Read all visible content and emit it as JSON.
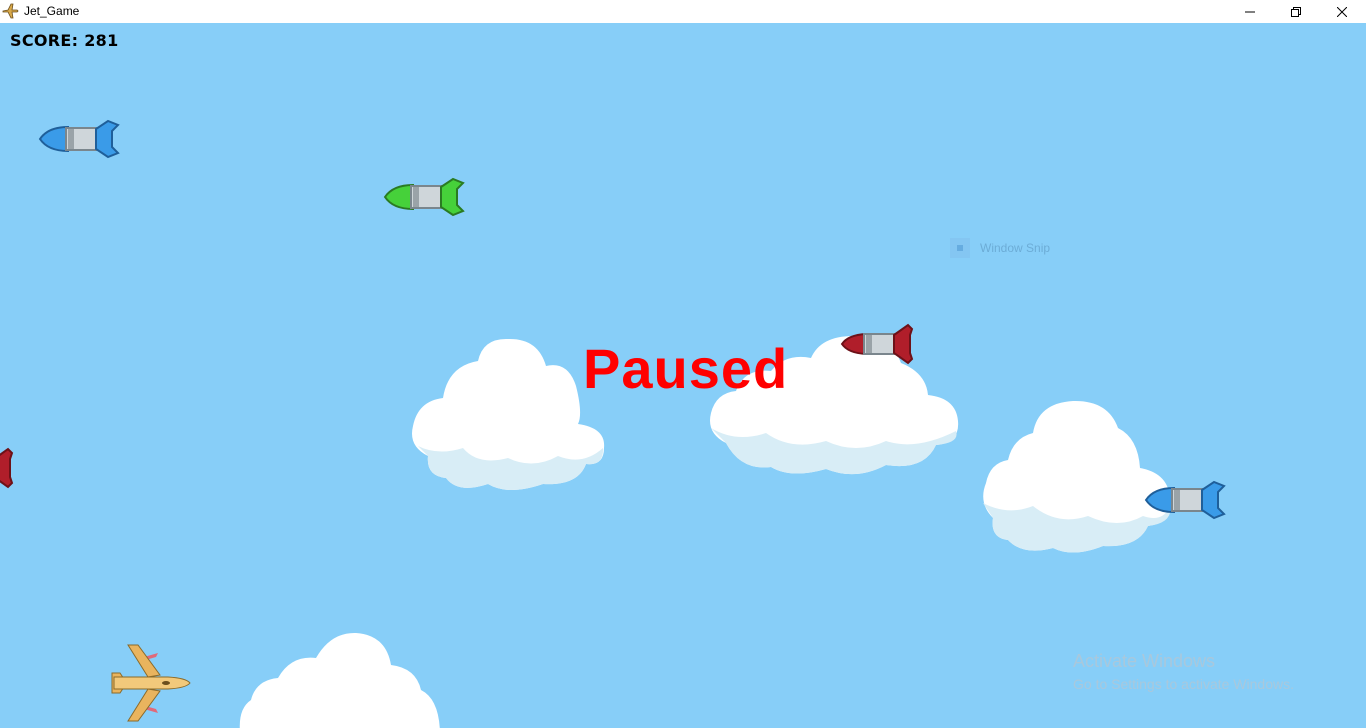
{
  "window": {
    "title": "Jet_Game",
    "minimize_icon": "minimize-icon",
    "restore_icon": "restore-icon",
    "close_icon": "close-icon"
  },
  "hud": {
    "score_label": "SCORE:",
    "score_value": "281"
  },
  "overlay": {
    "paused_text": "Paused"
  },
  "snip_tool": {
    "label": "Window Snip"
  },
  "watermark": {
    "line1": "Activate Windows",
    "line2": "Go to Settings to activate Windows."
  },
  "colors": {
    "sky": "#87CEF8",
    "paused": "#FF0000",
    "missile_blue": "#3A9BE8",
    "missile_green": "#46D13A",
    "missile_red": "#B01E2A",
    "jet": "#F2C97B"
  },
  "sprites": {
    "player": "player-jet",
    "enemies": [
      "blue-missile",
      "green-missile",
      "red-missile",
      "red-missile",
      "blue-missile"
    ],
    "clouds": [
      "cloud",
      "cloud",
      "cloud",
      "cloud"
    ]
  }
}
